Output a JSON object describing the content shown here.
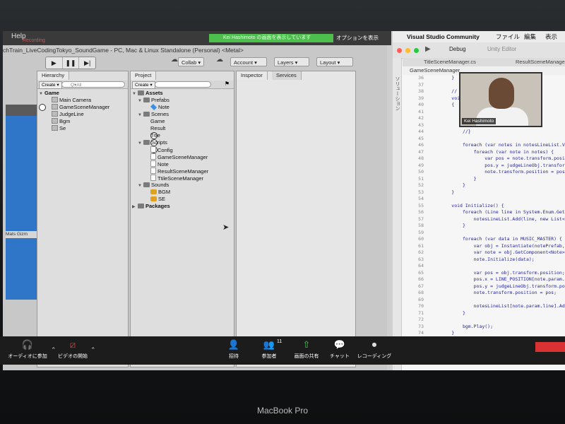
{
  "zoom_top": {
    "help": "Help",
    "recording": "Recording",
    "speaker_banner": "Kei Hashimoto の画面を表示しています",
    "options_button": "オプションを表示"
  },
  "unity": {
    "title": "chTrain_LiveCodingTokyo_SoundGame - PC, Mac & Linux Standalone (Personal) <Metal>",
    "play_buttons": [
      "▶",
      "❚❚",
      "▶|"
    ],
    "collab": "Collab ▾",
    "account": "Account ▾",
    "layers": "Layers ▾",
    "layout": "Layout ▾",
    "hierarchy": {
      "tab": "Hierarchy",
      "create": "Create ▾",
      "search": "Q▾All",
      "root": "Game",
      "items": [
        "Main Camera",
        "GameSceneManager",
        "JudgeLine",
        "Bgm",
        "Se"
      ]
    },
    "project": {
      "tab": "Project",
      "create": "Create ▾",
      "assets": "Assets",
      "prefabs": "Prefabs",
      "prefab_items": [
        "Note"
      ],
      "scenes": "Scenes",
      "scene_items": [
        "Game",
        "Result",
        "Title"
      ],
      "scripts": "Scripts",
      "script_items": [
        "Config",
        "GameSceneManager",
        "Note",
        "ResultSceneManager",
        "TtileSceneManager"
      ],
      "sounds": "Sounds",
      "sound_items": [
        "BGM",
        "SE"
      ],
      "packages": "Packages"
    },
    "inspector": {
      "tab": "Inspector",
      "services": "Services"
    },
    "scene_bar": "Mats  Gizm"
  },
  "vs": {
    "app": "Visual Studio Community",
    "menu": [
      "ファイル",
      "編集",
      "表示"
    ],
    "config": "Debug",
    "target": "Unity Editor",
    "tabs": [
      "TitleSceneManager.cs",
      "ResultSceneManager.c"
    ],
    "breadcrumb": "GameSceneManager",
    "side": "ソリューション",
    "video_name": "Kei Hashimoto",
    "code": [
      {
        "n": "36",
        "t": "        }"
      },
      {
        "n": "37",
        "t": ""
      },
      {
        "n": "38",
        "t": "        //"
      },
      {
        "n": "39",
        "t": "        voi"
      },
      {
        "n": "40",
        "t": "        {"
      },
      {
        "n": "41",
        "t": ""
      },
      {
        "n": "42",
        "t": "            "
      },
      {
        "n": "43",
        "t": "            "
      },
      {
        "n": "44",
        "t": "            //}"
      },
      {
        "n": "45",
        "t": ""
      },
      {
        "n": "46",
        "t": "            foreach (var notes in notesLineList.V"
      },
      {
        "n": "47",
        "t": "                foreach (var note in notes) {"
      },
      {
        "n": "48",
        "t": "                    var pos = note.transform.posi"
      },
      {
        "n": "49",
        "t": "                    pos.y = judgeLineObj.transfor"
      },
      {
        "n": "50",
        "t": "                    note.transform.position = pos"
      },
      {
        "n": "51",
        "t": "                }"
      },
      {
        "n": "52",
        "t": "            }"
      },
      {
        "n": "53",
        "t": "        }"
      },
      {
        "n": "54",
        "t": ""
      },
      {
        "n": "55",
        "t": "        void Initialize() {"
      },
      {
        "n": "56",
        "t": "            foreach (Line line in System.Enum.GetV"
      },
      {
        "n": "57",
        "t": "                notesLineList.Add(line, new List<"
      },
      {
        "n": "58",
        "t": "            }"
      },
      {
        "n": "59",
        "t": ""
      },
      {
        "n": "60",
        "t": "            foreach (var data in MUSIC_MASTER) {"
      },
      {
        "n": "61",
        "t": "                var obj = Instantiate(notePrefab,"
      },
      {
        "n": "62",
        "t": "                var note = obj.GetComponent<Note>"
      },
      {
        "n": "63",
        "t": "                note.Initialize(data);"
      },
      {
        "n": "64",
        "t": ""
      },
      {
        "n": "65",
        "t": "                var pos = obj.transform.position;"
      },
      {
        "n": "66",
        "t": "                pos.x = LINE_POSITION[note.param.l"
      },
      {
        "n": "67",
        "t": "                pos.y = judgeLineObj.transform.pos"
      },
      {
        "n": "68",
        "t": "                note.transform.position = pos;"
      },
      {
        "n": "69",
        "t": ""
      },
      {
        "n": "70",
        "t": "                notesLineList[note.param.line].Add"
      },
      {
        "n": "71",
        "t": "            }"
      },
      {
        "n": "72",
        "t": ""
      },
      {
        "n": "73",
        "t": "            bgm.Play();"
      },
      {
        "n": "74",
        "t": "        }"
      },
      {
        "n": "75",
        "t": "    }"
      }
    ]
  },
  "zoom_bar": {
    "audio": "オーディオに参加",
    "video": "ビデオの開始",
    "invite": "招待",
    "participants": "参加者",
    "participant_count": "11",
    "share": "画面の共有",
    "chat": "チャット",
    "record": "レコーディング"
  },
  "device": "MacBook Pro"
}
